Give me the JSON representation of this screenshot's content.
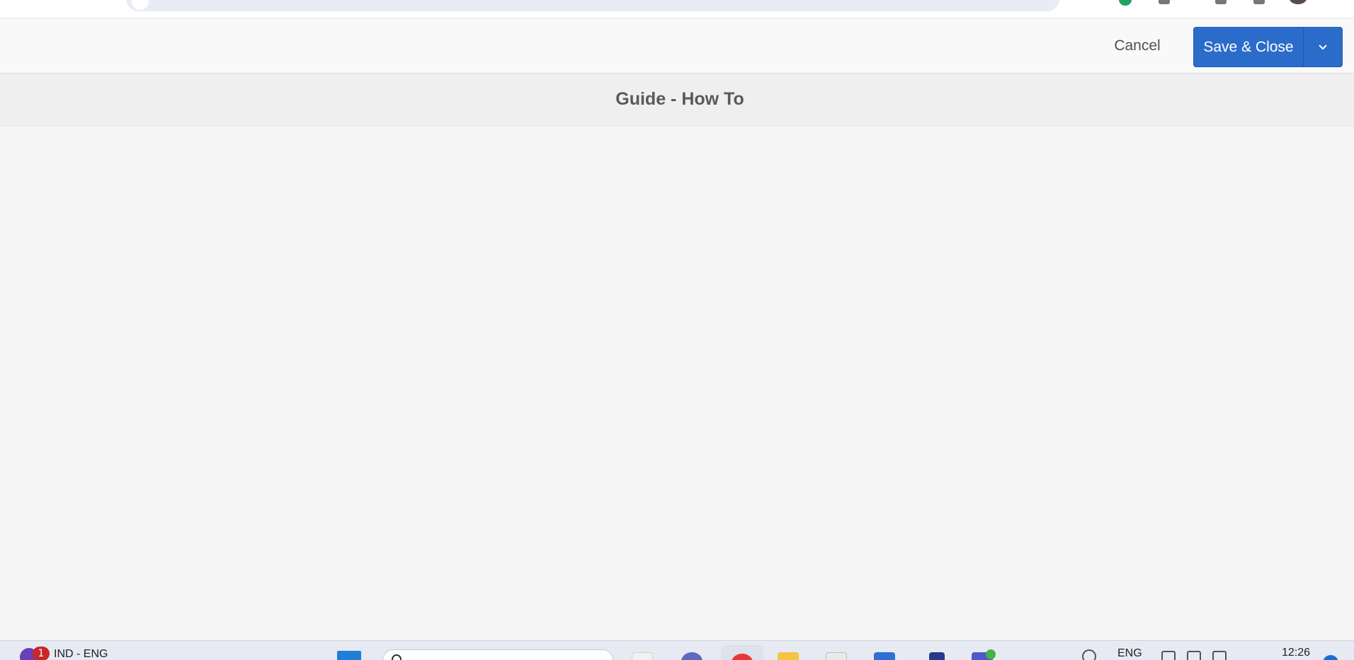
{
  "toolbar": {
    "cancel_label": "Cancel",
    "save_close_label": "Save & Close"
  },
  "header": {
    "title": "Guide - How To"
  },
  "taskbar": {
    "language_label": "IND - ENG",
    "language_badge_count": "1",
    "tray_language": "ENG",
    "clock_time": "12:26"
  },
  "icons": {
    "save_dropdown": "chevron-down-icon",
    "start": "windows-start-icon",
    "search": "search-icon"
  },
  "colors": {
    "primary_button": "#2b6ccb",
    "badge": "#c62828",
    "title_text": "#5a5a5a"
  }
}
